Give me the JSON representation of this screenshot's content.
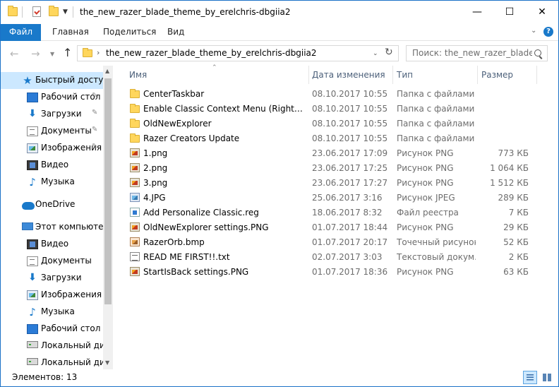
{
  "window": {
    "title": "the_new_razer_blade_theme_by_erelchris-dbgiia2",
    "minimize_glyph": "—",
    "maximize_glyph": "☐",
    "close_glyph": "✕"
  },
  "ribbon": {
    "tabs": [
      "Файл",
      "Главная",
      "Поделиться",
      "Вид"
    ]
  },
  "address": {
    "path": "the_new_razer_blade_theme_by_erelchris-dbgiia2"
  },
  "search": {
    "placeholder": "Поиск: the_new_razer_blade_t..."
  },
  "sidebar": {
    "items": [
      {
        "label": "Быстрый доступ",
        "icon": "star-icon"
      },
      {
        "label": "Рабочий стол",
        "icon": "desktop-icon"
      },
      {
        "label": "Загрузки",
        "icon": "downloads-icon"
      },
      {
        "label": "Документы",
        "icon": "documents-icon"
      },
      {
        "label": "Изображения",
        "icon": "pictures-icon"
      },
      {
        "label": "Видео",
        "icon": "video-icon"
      },
      {
        "label": "Музыка",
        "icon": "music-icon"
      },
      {
        "label": "OneDrive",
        "icon": "cloud-icon"
      },
      {
        "label": "Этот компьютер",
        "icon": "computer-icon"
      },
      {
        "label": "Видео",
        "icon": "video-icon"
      },
      {
        "label": "Документы",
        "icon": "documents-icon"
      },
      {
        "label": "Загрузки",
        "icon": "downloads-icon"
      },
      {
        "label": "Изображения",
        "icon": "pictures-icon"
      },
      {
        "label": "Музыка",
        "icon": "music-icon"
      },
      {
        "label": "Рабочий стол",
        "icon": "desktop-icon"
      },
      {
        "label": "Локальный дис",
        "icon": "drive-icon"
      },
      {
        "label": "Локальный дис",
        "icon": "drive-icon"
      }
    ]
  },
  "columns": {
    "name": "Имя",
    "date": "Дата изменения",
    "type": "Тип",
    "size": "Размер"
  },
  "files": [
    {
      "name": "CenterTaskbar",
      "date": "08.10.2017 10:55",
      "type": "Папка с файлами",
      "size": "",
      "icon": "folder-icon"
    },
    {
      "name": "Enable Classic Context Menu (Right Click...",
      "date": "08.10.2017 10:55",
      "type": "Папка с файлами",
      "size": "",
      "icon": "folder-icon"
    },
    {
      "name": "OldNewExplorer",
      "date": "08.10.2017 10:55",
      "type": "Папка с файлами",
      "size": "",
      "icon": "folder-icon"
    },
    {
      "name": "Razer Creators Update",
      "date": "08.10.2017 10:55",
      "type": "Папка с файлами",
      "size": "",
      "icon": "folder-icon"
    },
    {
      "name": "1.png",
      "date": "23.06.2017 17:09",
      "type": "Рисунок PNG",
      "size": "773 КБ",
      "icon": "png-icon"
    },
    {
      "name": "2.png",
      "date": "23.06.2017 17:25",
      "type": "Рисунок PNG",
      "size": "1 064 КБ",
      "icon": "png-icon"
    },
    {
      "name": "3.png",
      "date": "23.06.2017 17:27",
      "type": "Рисунок PNG",
      "size": "1 512 КБ",
      "icon": "png-icon"
    },
    {
      "name": "4.JPG",
      "date": "25.06.2017 3:16",
      "type": "Рисунок JPEG",
      "size": "289 КБ",
      "icon": "jpg-icon"
    },
    {
      "name": "Add Personalize Classic.reg",
      "date": "18.06.2017 8:32",
      "type": "Файл реестра",
      "size": "7 КБ",
      "icon": "reg-icon"
    },
    {
      "name": "OldNewExplorer settings.PNG",
      "date": "01.07.2017 18:44",
      "type": "Рисунок PNG",
      "size": "29 КБ",
      "icon": "png-icon"
    },
    {
      "name": "RazerOrb.bmp",
      "date": "01.07.2017 20:17",
      "type": "Точечный рисунок",
      "size": "52 КБ",
      "icon": "bmp-icon"
    },
    {
      "name": "READ ME FIRST!!.txt",
      "date": "02.07.2017 3:03",
      "type": "Текстовый докум...",
      "size": "2 КБ",
      "icon": "txt-icon"
    },
    {
      "name": "StartIsBack settings.PNG",
      "date": "01.07.2017 18:36",
      "type": "Рисунок PNG",
      "size": "63 КБ",
      "icon": "png-icon"
    }
  ],
  "status": {
    "items": "Элементов: 13"
  },
  "accent": "#1979ca"
}
